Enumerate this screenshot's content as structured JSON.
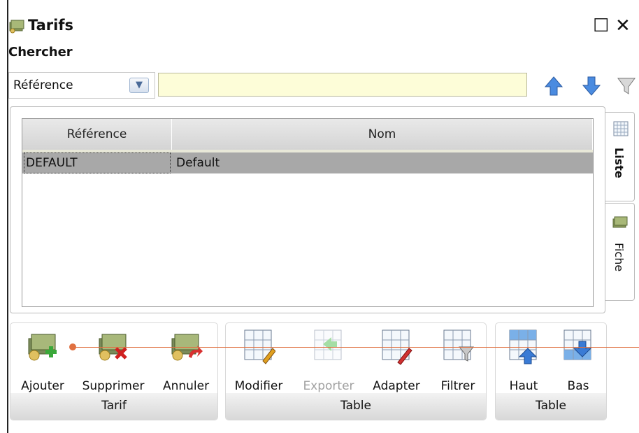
{
  "window": {
    "title": "Tarifs",
    "maximize_glyph": "☐",
    "close_glyph": "✕"
  },
  "search": {
    "label": "Chercher",
    "field_select": "Référence",
    "value": "",
    "up_icon": "arrow-up-icon",
    "down_icon": "arrow-down-icon",
    "filter_icon": "funnel-icon"
  },
  "table": {
    "columns": [
      "Référence",
      "Nom"
    ],
    "rows": [
      {
        "reference": "DEFAULT",
        "nom": "Default"
      }
    ]
  },
  "side_tabs": [
    {
      "label": "Liste",
      "icon": "grid-icon",
      "active": true
    },
    {
      "label": "Fiche",
      "icon": "form-icon",
      "active": false
    }
  ],
  "toolbar": {
    "tarif": {
      "label": "Tarif",
      "buttons": [
        {
          "label": "Ajouter",
          "icon": "add-money-icon"
        },
        {
          "label": "Supprimer",
          "icon": "delete-money-icon"
        },
        {
          "label": "Annuler",
          "icon": "undo-money-icon"
        }
      ]
    },
    "table": {
      "label": "Table",
      "buttons": [
        {
          "label": "Modifier",
          "icon": "table-edit-icon"
        },
        {
          "label": "Exporter",
          "icon": "table-export-icon",
          "disabled": true
        },
        {
          "label": "Adapter",
          "icon": "table-adapt-icon"
        },
        {
          "label": "Filtrer",
          "icon": "table-filter-icon"
        }
      ]
    },
    "table2": {
      "label": "Table",
      "buttons": [
        {
          "label": "Haut",
          "icon": "table-up-icon"
        },
        {
          "label": "Bas",
          "icon": "table-down-icon"
        }
      ]
    }
  },
  "colors": {
    "input_bg": "#fdfdd8",
    "arrow_blue": "#3a7bd5",
    "selected_row": "#a8a8a8",
    "annotation_line": "#e07040"
  }
}
